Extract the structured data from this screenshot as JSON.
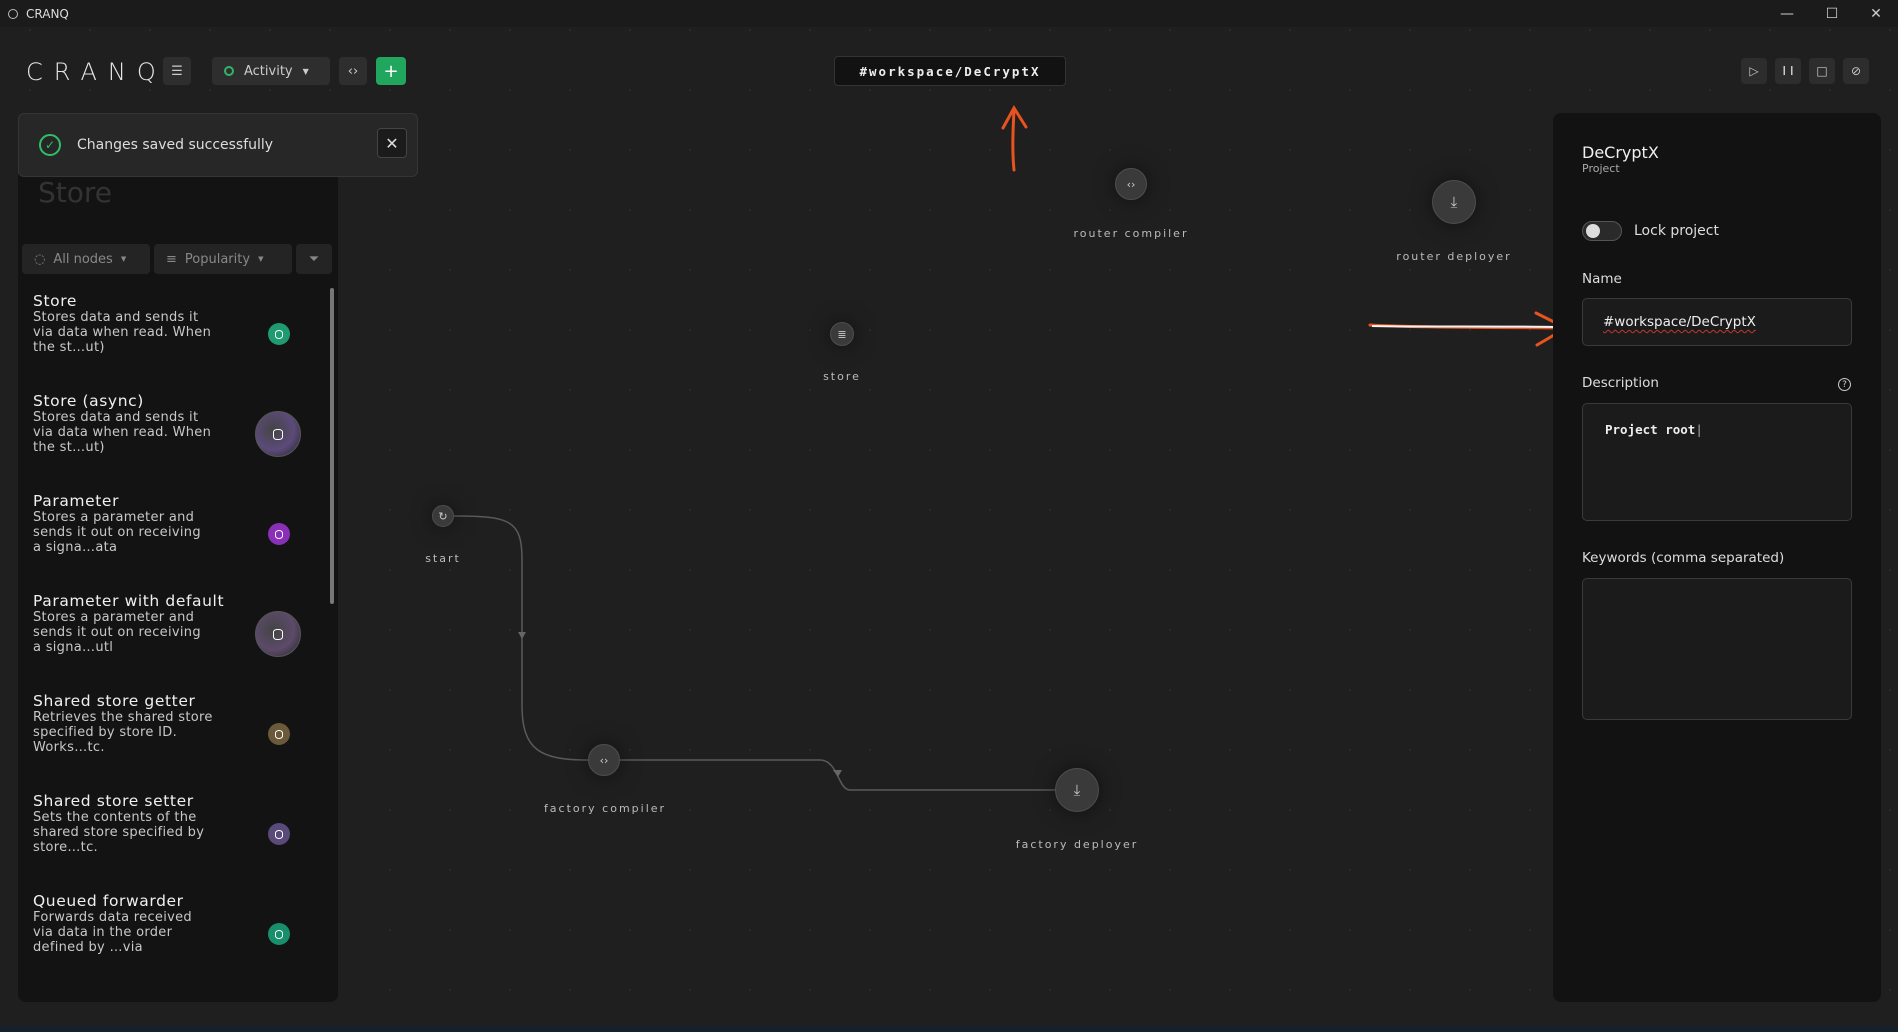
{
  "window": {
    "title": "CRANQ",
    "minimize": "—",
    "maximize": "☐",
    "close": "✕"
  },
  "toolbar": {
    "logo": "CRANQ",
    "menu_icon": "☰",
    "activity_label": "Activity",
    "code_icon": "‹›",
    "add_icon": "+",
    "workspace_title": "#workspace/DeCryptX",
    "run_icon": "▷",
    "pause_icon": "❙❙",
    "stop_icon": "□",
    "cancel_icon": "⊘"
  },
  "toast": {
    "message": "Changes saved successfully",
    "check_icon": "✓",
    "close_icon": "✕"
  },
  "sidebar": {
    "ghost_title": "Store",
    "filters": {
      "all_nodes": "All nodes",
      "popularity": "Popularity"
    },
    "items": [
      {
        "title": "Store",
        "desc": "Stores data and sends it via data when read. When the st…ut)",
        "icon_color": "#1f9b72",
        "icon_size": "small"
      },
      {
        "title": "Store (async)",
        "desc": "Stores data and sends it via data when read. When the st…ut)",
        "icon_color": "#5c4a7a",
        "icon_size": "big"
      },
      {
        "title": "Parameter",
        "desc": "Stores a parameter and sends it out on receiving a signa…ata",
        "icon_color": "#8a2fb8",
        "icon_size": "small"
      },
      {
        "title": "Parameter with default",
        "desc": "Stores a parameter and sends it out on receiving a signa…utl",
        "icon_color": "#5c4a6a",
        "icon_size": "big"
      },
      {
        "title": "Shared store getter",
        "desc": "Retrieves the shared store specified by store ID. Works…tc.",
        "icon_color": "#6a5a3a",
        "icon_size": "small"
      },
      {
        "title": "Shared store setter",
        "desc": "Sets the contents of the shared store specified by store…tc.",
        "icon_color": "#5a4a7a",
        "icon_size": "small"
      },
      {
        "title": "Queued forwarder",
        "desc": "Forwards data received via data in the order defined by …via",
        "icon_color": "#178f6a",
        "icon_size": "small"
      }
    ]
  },
  "canvas": {
    "nodes": [
      {
        "id": "router-compiler",
        "label": "router compiler",
        "icon": "‹›"
      },
      {
        "id": "router-deployer",
        "label": "router deployer",
        "icon": "⤓"
      },
      {
        "id": "store",
        "label": "store",
        "icon": "≣"
      },
      {
        "id": "start",
        "label": "start",
        "icon": "↻"
      },
      {
        "id": "factory-compiler",
        "label": "factory compiler",
        "icon": "‹›"
      },
      {
        "id": "factory-deployer",
        "label": "factory deployer",
        "icon": "⤓"
      }
    ]
  },
  "panel": {
    "title": "DeCryptX",
    "subtitle": "Project",
    "lock_label": "Lock project",
    "lock_on": false,
    "name_label": "Name",
    "name_value": "#workspace/DeCryptX",
    "description_label": "Description",
    "description_value": "Project root",
    "help_icon": "?",
    "keywords_label": "Keywords (comma separated)",
    "keywords_value": ""
  },
  "colors": {
    "accent_green": "#21a65d",
    "annotation_orange": "#e8531f"
  }
}
